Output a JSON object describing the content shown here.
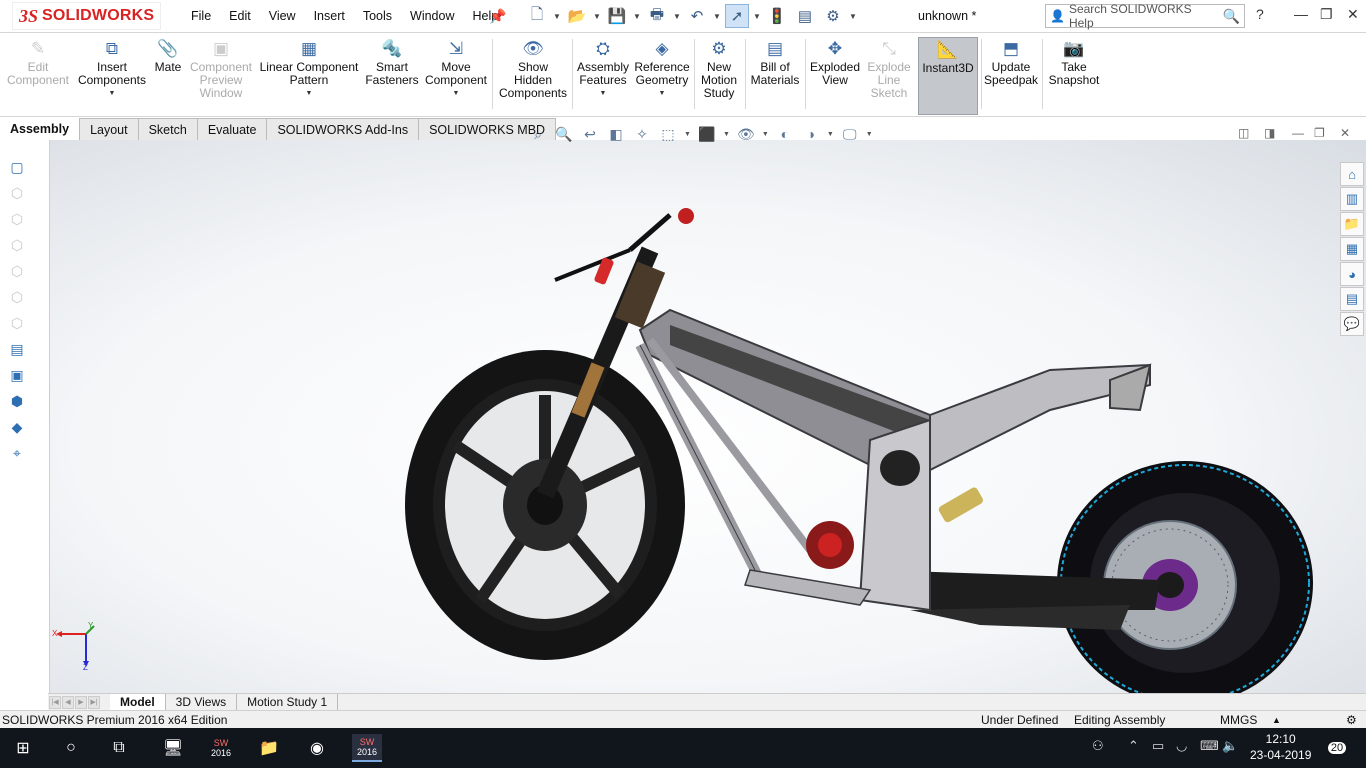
{
  "app": {
    "logo_mark": "3S",
    "logo_text": "SOLIDWORKS",
    "document_title": "unknown *"
  },
  "menu": [
    "File",
    "Edit",
    "View",
    "Insert",
    "Tools",
    "Window",
    "Help"
  ],
  "search": {
    "placeholder": "Search SOLIDWORKS Help"
  },
  "window_controls": {
    "help": "?",
    "minimize": "—",
    "restore": "❐",
    "close": "✕"
  },
  "ribbon": [
    {
      "label": "Edit\nComponent",
      "icon": "edit-component-icon",
      "enabled": false
    },
    {
      "label": "Insert\nComponents",
      "icon": "insert-components-icon",
      "enabled": true,
      "dropdown": true
    },
    {
      "label": "Mate",
      "icon": "mate-icon",
      "enabled": true
    },
    {
      "label": "Component\nPreview\nWindow",
      "icon": "preview-window-icon",
      "enabled": false
    },
    {
      "label": "Linear Component\nPattern",
      "icon": "linear-pattern-icon",
      "enabled": true,
      "dropdown": true
    },
    {
      "label": "Smart\nFasteners",
      "icon": "smart-fasteners-icon",
      "enabled": true
    },
    {
      "label": "Move\nComponent",
      "icon": "move-component-icon",
      "enabled": true,
      "dropdown": true
    },
    {
      "label": "Show\nHidden\nComponents",
      "icon": "show-hidden-icon",
      "enabled": true
    },
    {
      "label": "Assembly\nFeatures",
      "icon": "assembly-features-icon",
      "enabled": true,
      "dropdown": true
    },
    {
      "label": "Reference\nGeometry",
      "icon": "reference-geometry-icon",
      "enabled": true,
      "dropdown": true
    },
    {
      "label": "New\nMotion\nStudy",
      "icon": "motion-study-icon",
      "enabled": true
    },
    {
      "label": "Bill of\nMaterials",
      "icon": "bom-icon",
      "enabled": true
    },
    {
      "label": "Exploded\nView",
      "icon": "exploded-view-icon",
      "enabled": true
    },
    {
      "label": "Explode\nLine\nSketch",
      "icon": "explode-line-icon",
      "enabled": false
    },
    {
      "label": "Instant3D",
      "icon": "instant3d-icon",
      "enabled": true,
      "active": true
    },
    {
      "label": "Update\nSpeedpak",
      "icon": "speedpak-icon",
      "enabled": true
    },
    {
      "label": "Take\nSnapshot",
      "icon": "snapshot-icon",
      "enabled": true
    }
  ],
  "command_tabs": [
    "Assembly",
    "Layout",
    "Sketch",
    "Evaluate",
    "SOLIDWORKS Add-Ins",
    "SOLIDWORKS MBD"
  ],
  "bottom_tabs": [
    "Model",
    "3D Views",
    "Motion Study 1"
  ],
  "status": {
    "edition": "SOLIDWORKS Premium 2016 x64 Edition",
    "state": "Under Defined",
    "mode": "Editing Assembly",
    "units": "MMGS"
  },
  "taskbar": {
    "app_badge": "SW",
    "app_year": "2016",
    "time": "12:10",
    "date": "23-04-2019",
    "notifications": "20"
  },
  "colors": {
    "brand": "#d92323",
    "accent": "#2e6fb2",
    "taskbar": "#11151c"
  }
}
